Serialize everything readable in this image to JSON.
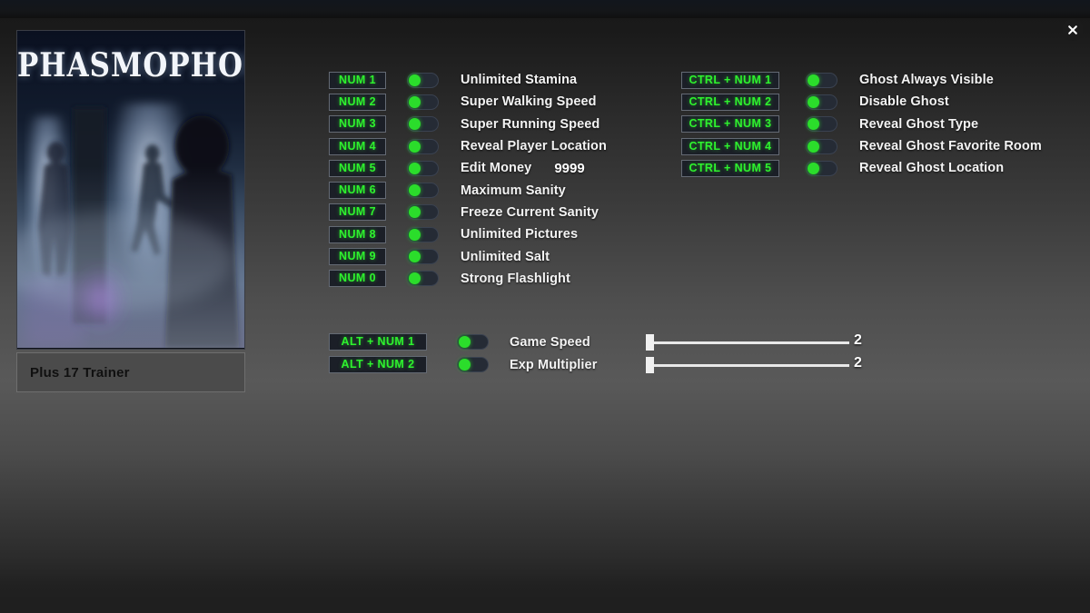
{
  "window": {
    "close_icon": "close-icon"
  },
  "sidebar": {
    "cover_title": "PHASMOPHOBIA",
    "trainer_label": "Plus 17 Trainer"
  },
  "colors": {
    "hotkey_text": "#2ef22e",
    "toggle_knob": "#2bdd2b",
    "hotkey_bg": "#1b1f27",
    "label_text": "#f3f3f3",
    "panel_bg": "#4b4b4b"
  },
  "options_column_1": [
    {
      "hotkey": "NUM 1",
      "label": "Unlimited Stamina",
      "enabled": true
    },
    {
      "hotkey": "NUM 2",
      "label": "Super Walking Speed",
      "enabled": true
    },
    {
      "hotkey": "NUM 3",
      "label": "Super Running Speed",
      "enabled": true
    },
    {
      "hotkey": "NUM 4",
      "label": "Reveal Player Location",
      "enabled": true
    },
    {
      "hotkey": "NUM 5",
      "label": "Edit Money",
      "enabled": true,
      "value": "9999"
    },
    {
      "hotkey": "NUM 6",
      "label": "Maximum Sanity",
      "enabled": true
    },
    {
      "hotkey": "NUM 7",
      "label": "Freeze Current Sanity",
      "enabled": true
    },
    {
      "hotkey": "NUM 8",
      "label": "Unlimited Pictures",
      "enabled": true
    },
    {
      "hotkey": "NUM 9",
      "label": "Unlimited Salt",
      "enabled": true
    },
    {
      "hotkey": "NUM 0",
      "label": "Strong Flashlight",
      "enabled": true
    }
  ],
  "options_column_2": [
    {
      "hotkey": "CTRL + NUM 1",
      "label": "Ghost Always Visible",
      "enabled": true
    },
    {
      "hotkey": "CTRL + NUM 2",
      "label": "Disable Ghost",
      "enabled": true
    },
    {
      "hotkey": "CTRL + NUM 3",
      "label": "Reveal Ghost Type",
      "enabled": true
    },
    {
      "hotkey": "CTRL + NUM 4",
      "label": "Reveal Ghost Favorite Room",
      "enabled": true
    },
    {
      "hotkey": "CTRL + NUM 5",
      "label": "Reveal Ghost Location",
      "enabled": true
    }
  ],
  "sliders": [
    {
      "hotkey": "ALT + NUM 1",
      "label": "Game Speed",
      "enabled": true,
      "value": "2",
      "position_pct": 0
    },
    {
      "hotkey": "ALT + NUM 2",
      "label": "Exp Multiplier",
      "enabled": true,
      "value": "2",
      "position_pct": 0
    }
  ]
}
